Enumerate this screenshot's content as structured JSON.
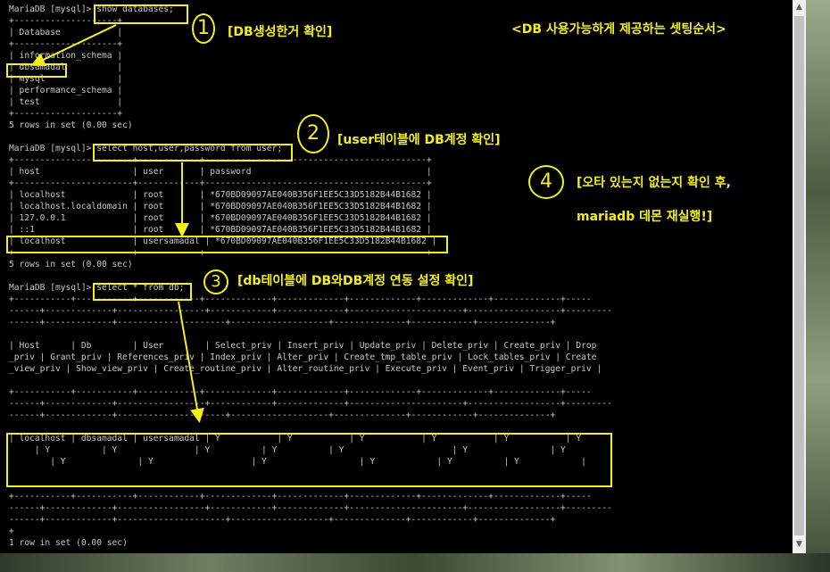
{
  "terminal": {
    "lines": [
      "MariaDB [mysql]> show databases;",
      "+--------------------+",
      "| Database           |",
      "+--------------------+",
      "| information_schema |",
      "| dbsamadal          |",
      "| mysql              |",
      "| performance_schema |",
      "| test               |",
      "+--------------------+",
      "5 rows in set (0.00 sec)",
      "",
      "MariaDB [mysql]> select host,user,password from user;",
      "+-----------------------+------------+-------------------------------------------+",
      "| host                  | user       | password                                  |",
      "+-----------------------+------------+-------------------------------------------+",
      "| localhost             | root       | *670BD09097AE040B356F1EE5C33D5182B44B1682 |",
      "| localhost.localdomain | root       | *670BD09097AE040B356F1EE5C33D5182B44B1682 |",
      "| 127.0.0.1             | root       | *670BD09097AE040B356F1EE5C33D5182B44B1682 |",
      "| ::1                   | root       | *670BD09097AE040B356F1EE5C33D5182B44B1682 |",
      "| localhost             | usersamadal | *670BD09097AE040B356F1EE5C33D5182B44B1682 |",
      "+-----------------------+------------+-------------------------------------------+",
      "5 rows in set (0.00 sec)",
      "",
      "MariaDB [mysql]> select * from db;",
      "+-----------+-----------+------------+-------------+-------------+-------------+-------------+-------------+-----",
      "------+-------------+-----------------+------------+-------------+----------------------+------------------+---------",
      "------+-------------+---------------------+-------------------+--------------+------------+--------------+",
      "",
      "| Host      | Db        | User        | Select_priv | Insert_priv | Update_priv | Delete_priv | Create_priv | Drop",
      "_priv | Grant_priv | References_priv | Index_priv | Alter_priv | Create_tmp_table_priv | Lock_tables_priv | Create",
      "_view_priv | Show_view_priv | Create_routine_priv | Alter_routine_priv | Execute_priv | Event_priv | Trigger_priv |",
      "",
      "+-----------+-----------+------------+-------------+-------------+-------------+-------------+-------------+-----",
      "------+-------------+-----------------+------------+-------------+----------------------+------------------+---------",
      "------+-------------+---------------------+-------------------+--------------+------------+--------------+",
      "",
      "| localhost | dbsamadal | usersamadal | Y           | Y           | Y           | Y           | Y           | Y",
      "     | Y          | Y               | Y          | Y          | Y                     | Y                | Y",
      "        | Y              | Y                   | Y                  | Y            | Y          | Y            |",
      "",
      "",
      "+-----------+-----------+------------+-------------+-------------+-------------+-------------+-------------+-----",
      "------+-------------+-----------------+------------+-------------+----------------------+------------------+---------",
      "------+-------------+---------------------+-------------------+--------------+------------+--------------+",
      "+",
      "1 row in set (0.00 sec)"
    ]
  },
  "annotations": {
    "step1_num": "1",
    "step1_label": "[DB생성한거 확인]",
    "header_label": "<DB 사용가능하게 제공하는 셋팅순서>",
    "step2_num": "2",
    "step2_label": "[user테이블에 DB계정 확인]",
    "step3_num": "3",
    "step3_label": "[db테이블에 DB와DB계정 연동 설정 확인]",
    "step4_num": "4",
    "step4_label_line1": "[오타 있는지 없는지 확인 후,",
    "step4_label_line2": "mariadb 데몬 재실행!]"
  },
  "colors": {
    "highlight": "#f5f01a",
    "terminal_bg": "#000000",
    "terminal_text": "#c8c8c8"
  }
}
